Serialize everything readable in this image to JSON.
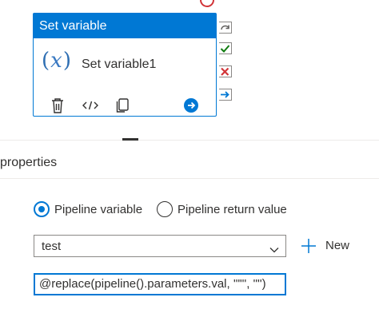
{
  "activity": {
    "type_label": "Set variable",
    "icon_glyph": "x",
    "name": "Set variable1",
    "tools": [
      "trash-icon",
      "code-icon",
      "copy-icon",
      "arrow-right-circle-icon"
    ]
  },
  "connectors": [
    "skip-icon",
    "success-check-icon",
    "failure-x-icon",
    "completion-arrow-icon"
  ],
  "properties": {
    "section_label": "properties",
    "variable_type": {
      "options": [
        "Pipeline variable",
        "Pipeline return value"
      ],
      "selected": "Pipeline variable"
    },
    "variable_name": {
      "value": "test",
      "new_label": "New"
    },
    "value_expression": "@replace(pipeline().parameters.val, '\"\"', '\"')"
  },
  "colors": {
    "accent": "#0078d4",
    "success": "#107c10",
    "failure": "#d13438"
  }
}
